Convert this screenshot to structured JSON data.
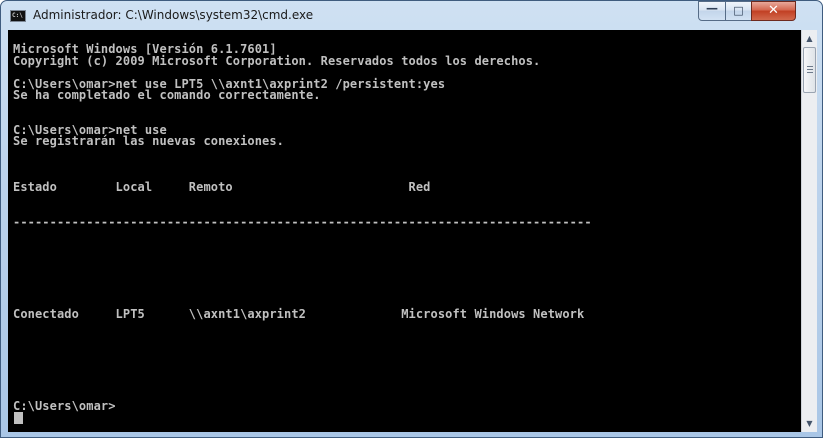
{
  "window": {
    "title": "Administrador: C:\\Windows\\system32\\cmd.exe",
    "app_icon_text": "C:\\",
    "controls": {
      "minimize": "—",
      "maximize": "□",
      "close": "✕"
    }
  },
  "console": {
    "lines": [
      "Microsoft Windows [Versión 6.1.7601]",
      "Copyright (c) 2009 Microsoft Corporation. Reservados todos los derechos.",
      "",
      "C:\\Users\\omar>net use LPT5 \\\\axnt1\\axprint2 /persistent:yes",
      "Se ha completado el comando correctamente.",
      "",
      "",
      "C:\\Users\\omar>net use",
      "Se registrarán las nuevas conexiones.",
      "",
      "",
      "",
      "Estado        Local     Remoto                        Red",
      "",
      "",
      "-------------------------------------------------------------------------------",
      "",
      "",
      "",
      "",
      "",
      "",
      "",
      "Conectado     LPT5      \\\\axnt1\\axprint2             Microsoft Windows Network",
      "",
      "",
      "",
      "",
      "",
      "",
      ""
    ],
    "prompt": "C:\\Users\\omar>"
  },
  "scrollbar": {
    "up": "▲",
    "down": "▼",
    "thumb_position": 0.0
  }
}
